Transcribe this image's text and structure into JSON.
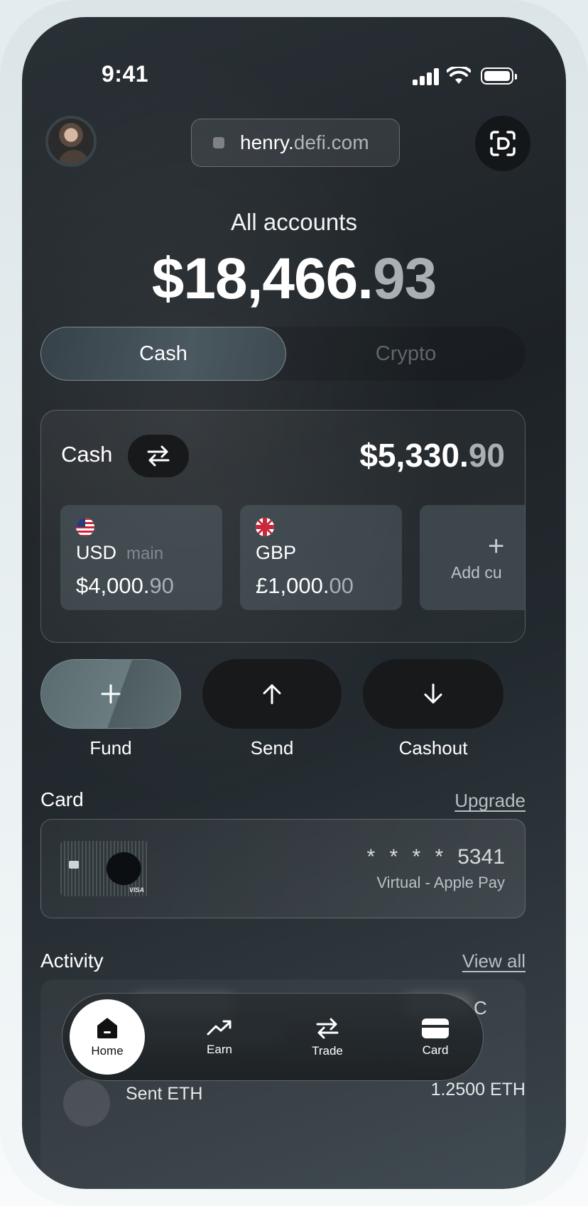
{
  "status_bar": {
    "time": "9:41"
  },
  "header": {
    "url_prefix": "henry.",
    "url_suffix": "defi.com"
  },
  "accounts": {
    "title": "All accounts",
    "balance_main": "$18,466.",
    "balance_cents": "93"
  },
  "segment": {
    "tabs": [
      "Cash",
      "Crypto"
    ],
    "selected": "Cash"
  },
  "cash_card": {
    "label": "Cash",
    "total_main": "$5,330.",
    "total_cents": "90",
    "currencies": [
      {
        "code": "USD",
        "tag": "main",
        "amount_main": "$4,000.",
        "amount_cents": "90",
        "flag": "us-flag-icon"
      },
      {
        "code": "GBP",
        "tag": "",
        "amount_main": "£1,000.",
        "amount_cents": "00",
        "flag": "uk-flag-icon"
      }
    ],
    "add_label": "Add cu"
  },
  "actions": [
    {
      "label": "Fund",
      "icon": "plus-icon"
    },
    {
      "label": "Send",
      "icon": "arrow-up-icon"
    },
    {
      "label": "Cashout",
      "icon": "arrow-down-icon"
    }
  ],
  "card_section": {
    "title": "Card",
    "link": "Upgrade",
    "mask": "* * * *",
    "last4": "5341",
    "subtitle": "Virtual - Apple Pay",
    "brand": "VISA"
  },
  "activity": {
    "title": "Activity",
    "link": "View all",
    "rows": [
      {
        "label": "Sent ETH",
        "amount": "1.2500 ETH"
      }
    ],
    "partial_amount_char": "C"
  },
  "tabbar": {
    "items": [
      {
        "label": "Home",
        "icon": "home-icon",
        "active": true
      },
      {
        "label": "Earn",
        "icon": "trend-icon"
      },
      {
        "label": "Trade",
        "icon": "swap-icon"
      },
      {
        "label": "Card",
        "icon": "card-icon"
      }
    ]
  },
  "colors": {
    "accent_fund": "#5e6f73",
    "muted_cents": "#a9b0b5",
    "screen_bg": "#1f2428"
  }
}
